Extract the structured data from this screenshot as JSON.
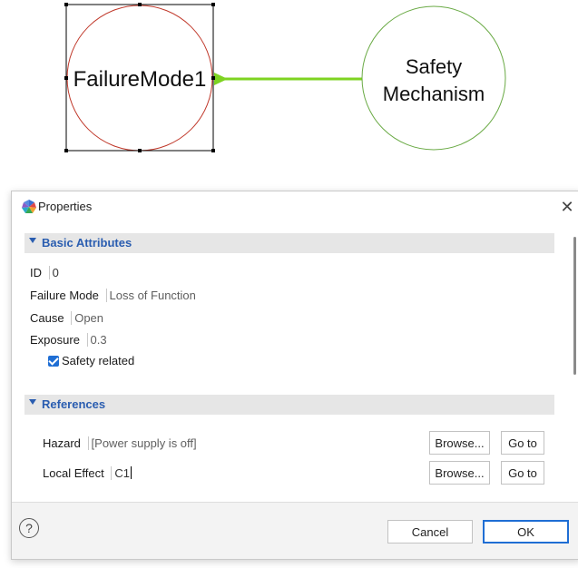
{
  "diagram": {
    "failure_mode_label": "FailureMode1",
    "safety_mechanism_label_line1": "Safety",
    "safety_mechanism_label_line2": "Mechanism",
    "colors": {
      "failure_node_stroke": "#c0392b",
      "safety_node_stroke": "#6aaa45",
      "connector": "#7ed321",
      "selection": "#000000"
    }
  },
  "dialog": {
    "title": "Properties",
    "close_label": "✕",
    "basic_section": {
      "title": "Basic Attributes",
      "fields": [
        {
          "label": "ID",
          "value": "0"
        },
        {
          "label": "Failure Mode",
          "value": "Loss of Function"
        },
        {
          "label": "Cause",
          "value": "Open"
        },
        {
          "label": "Exposure",
          "value": "0.3"
        }
      ],
      "checkbox_label": "Safety related",
      "checkbox_checked": true
    },
    "references_section": {
      "title": "References",
      "rows": [
        {
          "label": "Hazard",
          "value": "[Power supply is off]",
          "browse": "Browse...",
          "goto": "Go to"
        },
        {
          "label": "Local Effect",
          "value": "C1",
          "browse": "Browse...",
          "goto": "Go to"
        }
      ]
    },
    "footer": {
      "help": "?",
      "cancel": "Cancel",
      "ok": "OK"
    }
  }
}
